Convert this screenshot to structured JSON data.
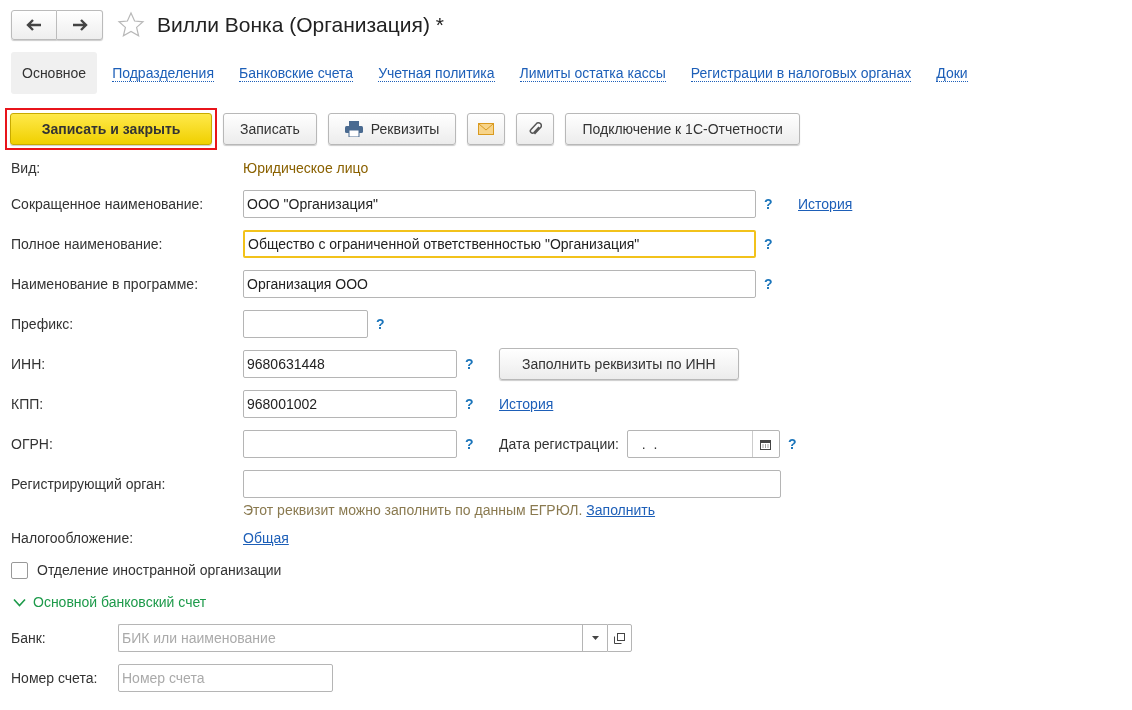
{
  "header": {
    "favorite": false,
    "title": "Вилли Вонка (Организация) *"
  },
  "tabs": [
    {
      "label": "Основное",
      "selected": true
    },
    {
      "label": "Подразделения",
      "selected": false
    },
    {
      "label": "Банковские счета",
      "selected": false
    },
    {
      "label": "Учетная политика",
      "selected": false
    },
    {
      "label": "Лимиты остатка кассы",
      "selected": false
    },
    {
      "label": "Регистрации в налоговых органах",
      "selected": false
    },
    {
      "label": "Доки",
      "selected": false
    }
  ],
  "toolbar": [
    {
      "kind": "primary",
      "label": "Записать и закрыть",
      "highlighted": true
    },
    {
      "kind": "text",
      "label": "Записать",
      "highlighted": false
    },
    {
      "kind": "print",
      "label": "Реквизиты",
      "highlighted": false
    },
    {
      "kind": "mail",
      "highlighted": false
    },
    {
      "kind": "clip",
      "highlighted": false
    },
    {
      "kind": "text",
      "label": "Подключение к 1С-Отчетности",
      "highlighted": false
    }
  ],
  "form": {
    "type": {
      "label": "Вид:",
      "value": "Юридическое лицо"
    },
    "short_name": {
      "label": "Сокращенное наименование:",
      "value": "ООО \"Организация\"",
      "focused": false,
      "help": "?",
      "link": "История"
    },
    "full_name": {
      "label": "Полное наименование:",
      "value": "Общество с ограниченной ответственностью \"Организация\"",
      "focused": true,
      "help": "?"
    },
    "program_name": {
      "label": "Наименование в программе:",
      "value": "Организация ООО",
      "focused": false,
      "help": "?"
    },
    "prefix": {
      "label": "Префикс:",
      "focused": false,
      "help": "?"
    },
    "inn": {
      "label": "ИНН:",
      "value": "9680631448",
      "focused": false,
      "help": "?",
      "button": "Заполнить реквизиты по ИНН"
    },
    "kpp": {
      "label": "КПП:",
      "value": "968001002",
      "focused": false,
      "help": "?",
      "link": "История"
    },
    "ogrn": {
      "label": "ОГРН:",
      "focused": false,
      "help": "?",
      "date_label": "Дата регистрации:",
      "date_value": "  .  .",
      "date_help": "?"
    },
    "registrar": {
      "label": "Регистрирующий орган:",
      "focused": false,
      "hint": "Этот реквизит можно заполнить по данным ЕГРЮЛ.",
      "hint_link": "Заполнить"
    },
    "taxation": {
      "label": "Налогообложение:",
      "link": "Общая"
    },
    "foreign_branch": {
      "label": "Отделение иностранной организации",
      "checked": false
    },
    "bank_section": {
      "title": "Основной банковский счет",
      "expanded": true,
      "bank": {
        "label": "Банк:",
        "placeholder": "БИК или наименование"
      },
      "account": {
        "label": "Номер счета:",
        "placeholder": "Номер счета"
      }
    }
  }
}
